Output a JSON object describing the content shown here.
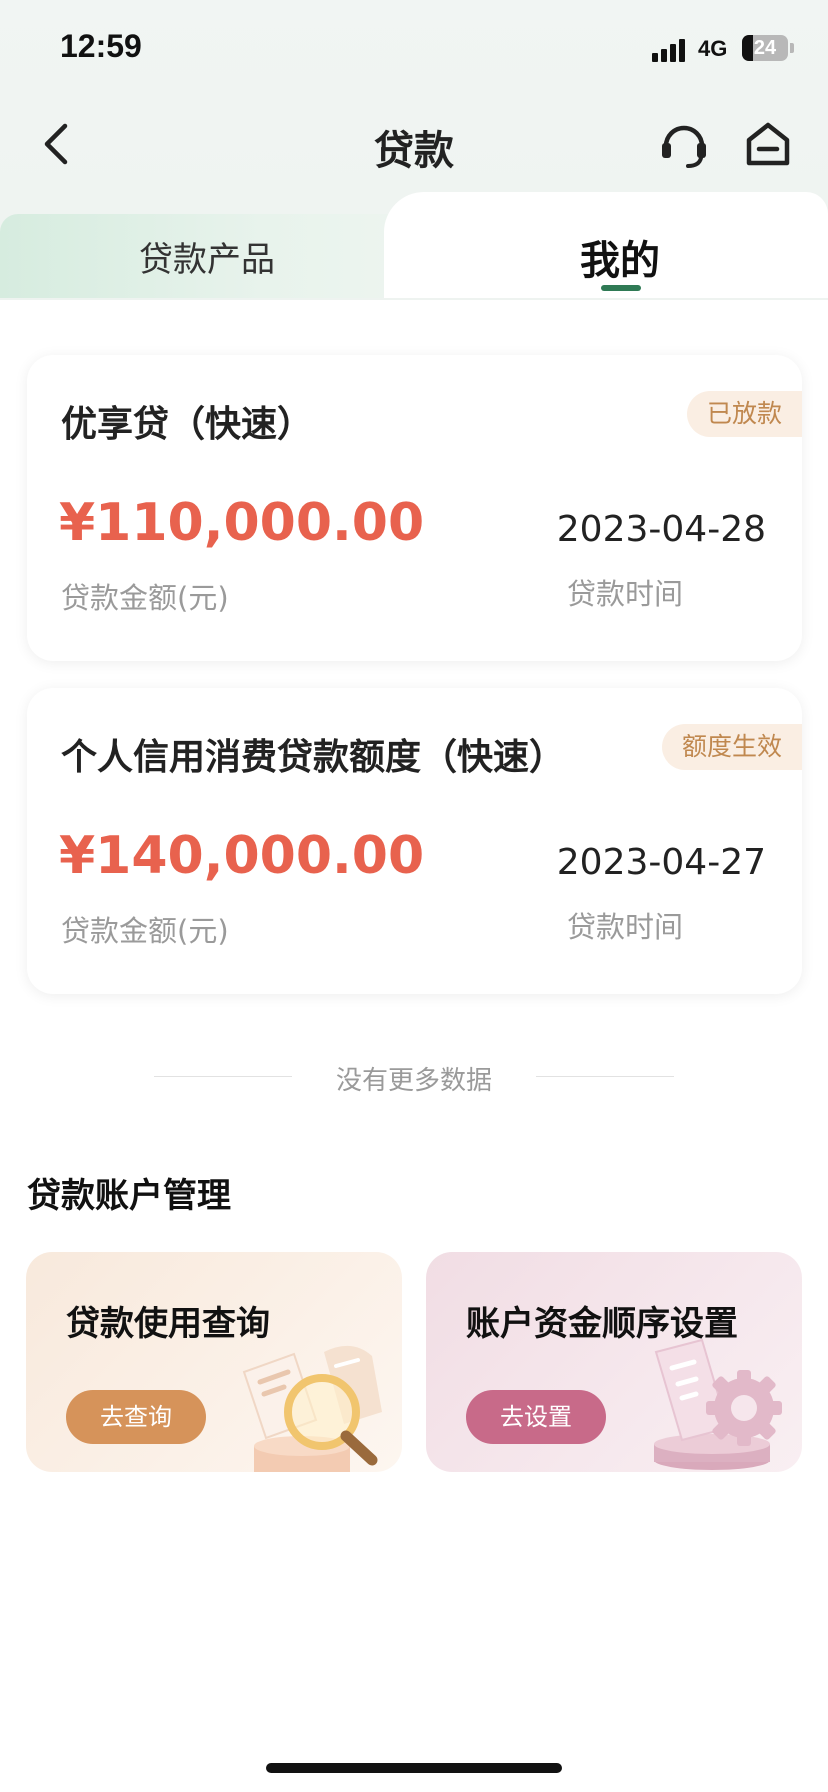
{
  "status_bar": {
    "time": "12:59",
    "network": "4G",
    "battery": "24",
    "battery_level": 0.24
  },
  "nav": {
    "title": "贷款",
    "back_icon": "chevron-left-icon",
    "service_icon": "headset-icon",
    "home_icon": "home-icon"
  },
  "tabs": {
    "products_label": "贷款产品",
    "mine_label": "我的",
    "active": "mine",
    "accent_color": "#2f7a55"
  },
  "loans": [
    {
      "name": "优享贷（快速）",
      "badge": "已放款",
      "amount": "¥110,000.00",
      "amount_label": "贷款金额(元)",
      "date": "2023-04-28",
      "date_label": "贷款时间"
    },
    {
      "name": "个人信用消费贷款额度（快速）",
      "badge": "额度生效",
      "amount": "¥140,000.00",
      "amount_label": "贷款金额(元)",
      "date": "2023-04-27",
      "date_label": "贷款时间"
    }
  ],
  "no_more": "没有更多数据",
  "management": {
    "title": "贷款账户管理",
    "cards": [
      {
        "title": "贷款使用查询",
        "button": "去查询",
        "icon": "document-magnifier-icon"
      },
      {
        "title": "账户资金顺序设置",
        "button": "去设置",
        "icon": "phone-gear-icon"
      }
    ]
  },
  "colors": {
    "amount": "#e8624e",
    "badge_text": "#c0884f",
    "query_button": "#d6935a",
    "setting_button": "#c86a89"
  }
}
